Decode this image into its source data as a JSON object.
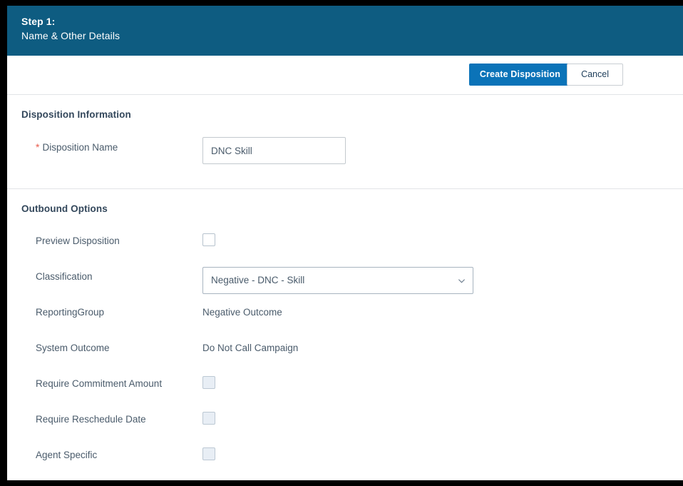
{
  "header": {
    "step_number": "Step 1:",
    "step_title": "Name & Other Details",
    "background_color": "#0e5c81"
  },
  "action_bar": {
    "primary_button": "Create Disposition",
    "secondary_button": "Cancel",
    "primary_color": "#0b73b8"
  },
  "sections": [
    {
      "title": "Disposition Information",
      "fields": [
        {
          "label": "Disposition Name",
          "required": true,
          "type": "text",
          "value": "DNC Skill",
          "placeholder": ""
        }
      ]
    },
    {
      "title": "Outbound Options",
      "fields": [
        {
          "label": "Preview Disposition",
          "required": false,
          "type": "checkbox",
          "checked": false,
          "disabled": false
        },
        {
          "label": "Classification",
          "required": false,
          "type": "select",
          "value": "Negative - DNC - Skill",
          "icon": "chevron-down-icon"
        },
        {
          "label": "ReportingGroup",
          "required": false,
          "type": "static",
          "value": "Negative Outcome"
        },
        {
          "label": "System Outcome",
          "required": false,
          "type": "static",
          "value": "Do Not Call Campaign"
        },
        {
          "label": "Require Commitment Amount",
          "required": false,
          "type": "checkbox",
          "checked": false,
          "disabled": true
        },
        {
          "label": "Require Reschedule Date",
          "required": false,
          "type": "checkbox",
          "checked": false,
          "disabled": true
        },
        {
          "label": "Agent Specific",
          "required": false,
          "type": "checkbox",
          "checked": false,
          "disabled": true
        }
      ]
    }
  ],
  "required_marker": "*"
}
